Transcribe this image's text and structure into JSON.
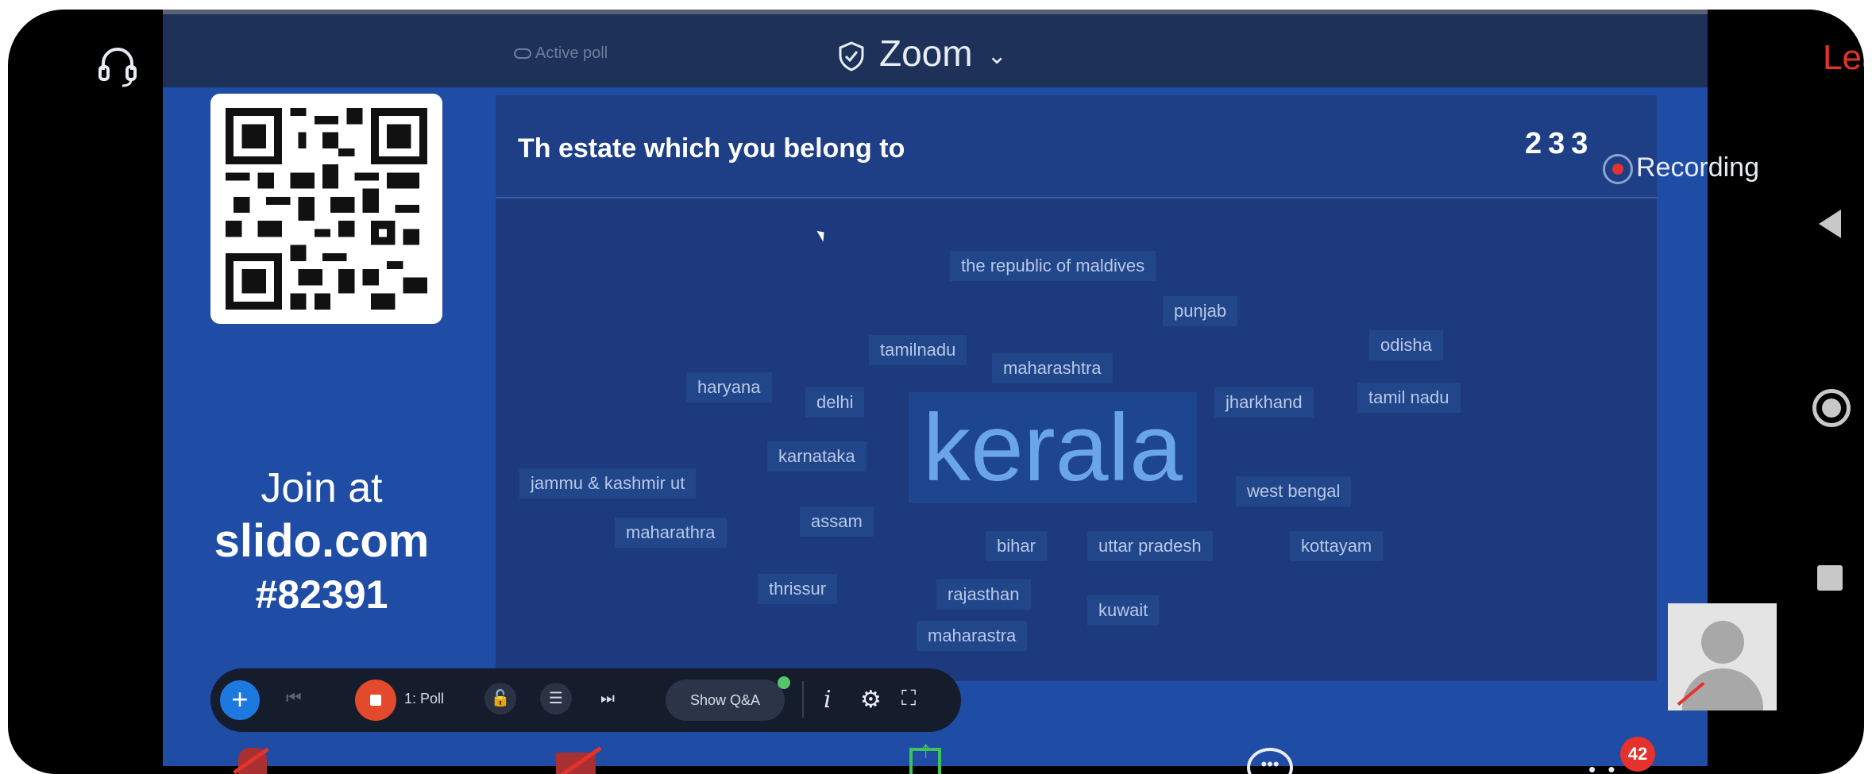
{
  "zoom_bar": {
    "active_poll": "Active poll",
    "title": "Zoom",
    "leave": "Leave"
  },
  "slido": {
    "join_label": "Join at",
    "join_site": "slido.com",
    "join_code": "#82391"
  },
  "poll": {
    "question": "Th estate which you belong to",
    "vote_count": "233",
    "words": [
      "the republic of maldives",
      "punjab",
      "tamilnadu",
      "odisha",
      "maharashtra",
      "haryana",
      "delhi",
      "jharkhand",
      "tamil nadu",
      "kerala",
      "karnataka",
      "jammu & kashmir ut",
      "west bengal",
      "assam",
      "maharathra",
      "bihar",
      "uttar pradesh",
      "kottayam",
      "thrissur",
      "rajasthan",
      "kuwait",
      "maharastra"
    ]
  },
  "recording": {
    "label": "Recording"
  },
  "controls": {
    "poll_label": "1: Poll",
    "show_qa": "Show Q&A",
    "info": "i"
  },
  "toolbar": {
    "chat_glyph": "•••",
    "more_glyph": "• •",
    "badge_count": "42"
  },
  "colors": {
    "accent_red": "#e4332c",
    "slide_blue": "#1f4da6",
    "share_green": "#3fc25a"
  }
}
